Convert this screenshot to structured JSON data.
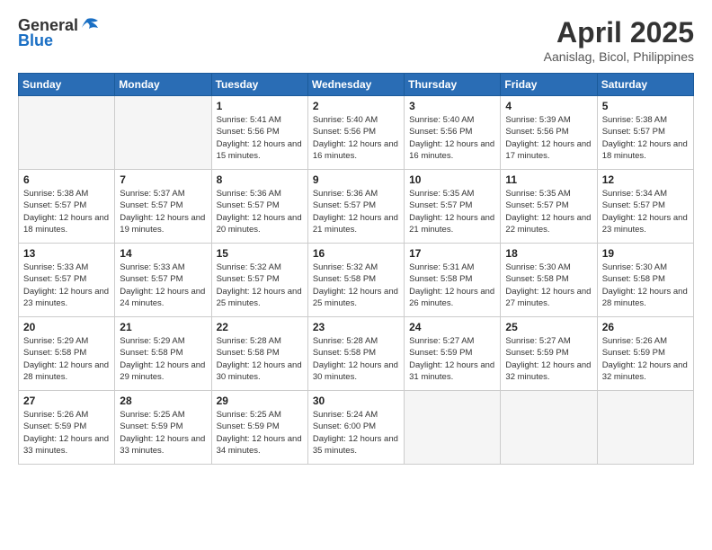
{
  "logo": {
    "general": "General",
    "blue": "Blue"
  },
  "title": "April 2025",
  "subtitle": "Aanislag, Bicol, Philippines",
  "days_of_week": [
    "Sunday",
    "Monday",
    "Tuesday",
    "Wednesday",
    "Thursday",
    "Friday",
    "Saturday"
  ],
  "weeks": [
    [
      {
        "day": "",
        "info": ""
      },
      {
        "day": "",
        "info": ""
      },
      {
        "day": "1",
        "info": "Sunrise: 5:41 AM\nSunset: 5:56 PM\nDaylight: 12 hours and 15 minutes."
      },
      {
        "day": "2",
        "info": "Sunrise: 5:40 AM\nSunset: 5:56 PM\nDaylight: 12 hours and 16 minutes."
      },
      {
        "day": "3",
        "info": "Sunrise: 5:40 AM\nSunset: 5:56 PM\nDaylight: 12 hours and 16 minutes."
      },
      {
        "day": "4",
        "info": "Sunrise: 5:39 AM\nSunset: 5:56 PM\nDaylight: 12 hours and 17 minutes."
      },
      {
        "day": "5",
        "info": "Sunrise: 5:38 AM\nSunset: 5:57 PM\nDaylight: 12 hours and 18 minutes."
      }
    ],
    [
      {
        "day": "6",
        "info": "Sunrise: 5:38 AM\nSunset: 5:57 PM\nDaylight: 12 hours and 18 minutes."
      },
      {
        "day": "7",
        "info": "Sunrise: 5:37 AM\nSunset: 5:57 PM\nDaylight: 12 hours and 19 minutes."
      },
      {
        "day": "8",
        "info": "Sunrise: 5:36 AM\nSunset: 5:57 PM\nDaylight: 12 hours and 20 minutes."
      },
      {
        "day": "9",
        "info": "Sunrise: 5:36 AM\nSunset: 5:57 PM\nDaylight: 12 hours and 21 minutes."
      },
      {
        "day": "10",
        "info": "Sunrise: 5:35 AM\nSunset: 5:57 PM\nDaylight: 12 hours and 21 minutes."
      },
      {
        "day": "11",
        "info": "Sunrise: 5:35 AM\nSunset: 5:57 PM\nDaylight: 12 hours and 22 minutes."
      },
      {
        "day": "12",
        "info": "Sunrise: 5:34 AM\nSunset: 5:57 PM\nDaylight: 12 hours and 23 minutes."
      }
    ],
    [
      {
        "day": "13",
        "info": "Sunrise: 5:33 AM\nSunset: 5:57 PM\nDaylight: 12 hours and 23 minutes."
      },
      {
        "day": "14",
        "info": "Sunrise: 5:33 AM\nSunset: 5:57 PM\nDaylight: 12 hours and 24 minutes."
      },
      {
        "day": "15",
        "info": "Sunrise: 5:32 AM\nSunset: 5:57 PM\nDaylight: 12 hours and 25 minutes."
      },
      {
        "day": "16",
        "info": "Sunrise: 5:32 AM\nSunset: 5:58 PM\nDaylight: 12 hours and 25 minutes."
      },
      {
        "day": "17",
        "info": "Sunrise: 5:31 AM\nSunset: 5:58 PM\nDaylight: 12 hours and 26 minutes."
      },
      {
        "day": "18",
        "info": "Sunrise: 5:30 AM\nSunset: 5:58 PM\nDaylight: 12 hours and 27 minutes."
      },
      {
        "day": "19",
        "info": "Sunrise: 5:30 AM\nSunset: 5:58 PM\nDaylight: 12 hours and 28 minutes."
      }
    ],
    [
      {
        "day": "20",
        "info": "Sunrise: 5:29 AM\nSunset: 5:58 PM\nDaylight: 12 hours and 28 minutes."
      },
      {
        "day": "21",
        "info": "Sunrise: 5:29 AM\nSunset: 5:58 PM\nDaylight: 12 hours and 29 minutes."
      },
      {
        "day": "22",
        "info": "Sunrise: 5:28 AM\nSunset: 5:58 PM\nDaylight: 12 hours and 30 minutes."
      },
      {
        "day": "23",
        "info": "Sunrise: 5:28 AM\nSunset: 5:58 PM\nDaylight: 12 hours and 30 minutes."
      },
      {
        "day": "24",
        "info": "Sunrise: 5:27 AM\nSunset: 5:59 PM\nDaylight: 12 hours and 31 minutes."
      },
      {
        "day": "25",
        "info": "Sunrise: 5:27 AM\nSunset: 5:59 PM\nDaylight: 12 hours and 32 minutes."
      },
      {
        "day": "26",
        "info": "Sunrise: 5:26 AM\nSunset: 5:59 PM\nDaylight: 12 hours and 32 minutes."
      }
    ],
    [
      {
        "day": "27",
        "info": "Sunrise: 5:26 AM\nSunset: 5:59 PM\nDaylight: 12 hours and 33 minutes."
      },
      {
        "day": "28",
        "info": "Sunrise: 5:25 AM\nSunset: 5:59 PM\nDaylight: 12 hours and 33 minutes."
      },
      {
        "day": "29",
        "info": "Sunrise: 5:25 AM\nSunset: 5:59 PM\nDaylight: 12 hours and 34 minutes."
      },
      {
        "day": "30",
        "info": "Sunrise: 5:24 AM\nSunset: 6:00 PM\nDaylight: 12 hours and 35 minutes."
      },
      {
        "day": "",
        "info": ""
      },
      {
        "day": "",
        "info": ""
      },
      {
        "day": "",
        "info": ""
      }
    ]
  ]
}
